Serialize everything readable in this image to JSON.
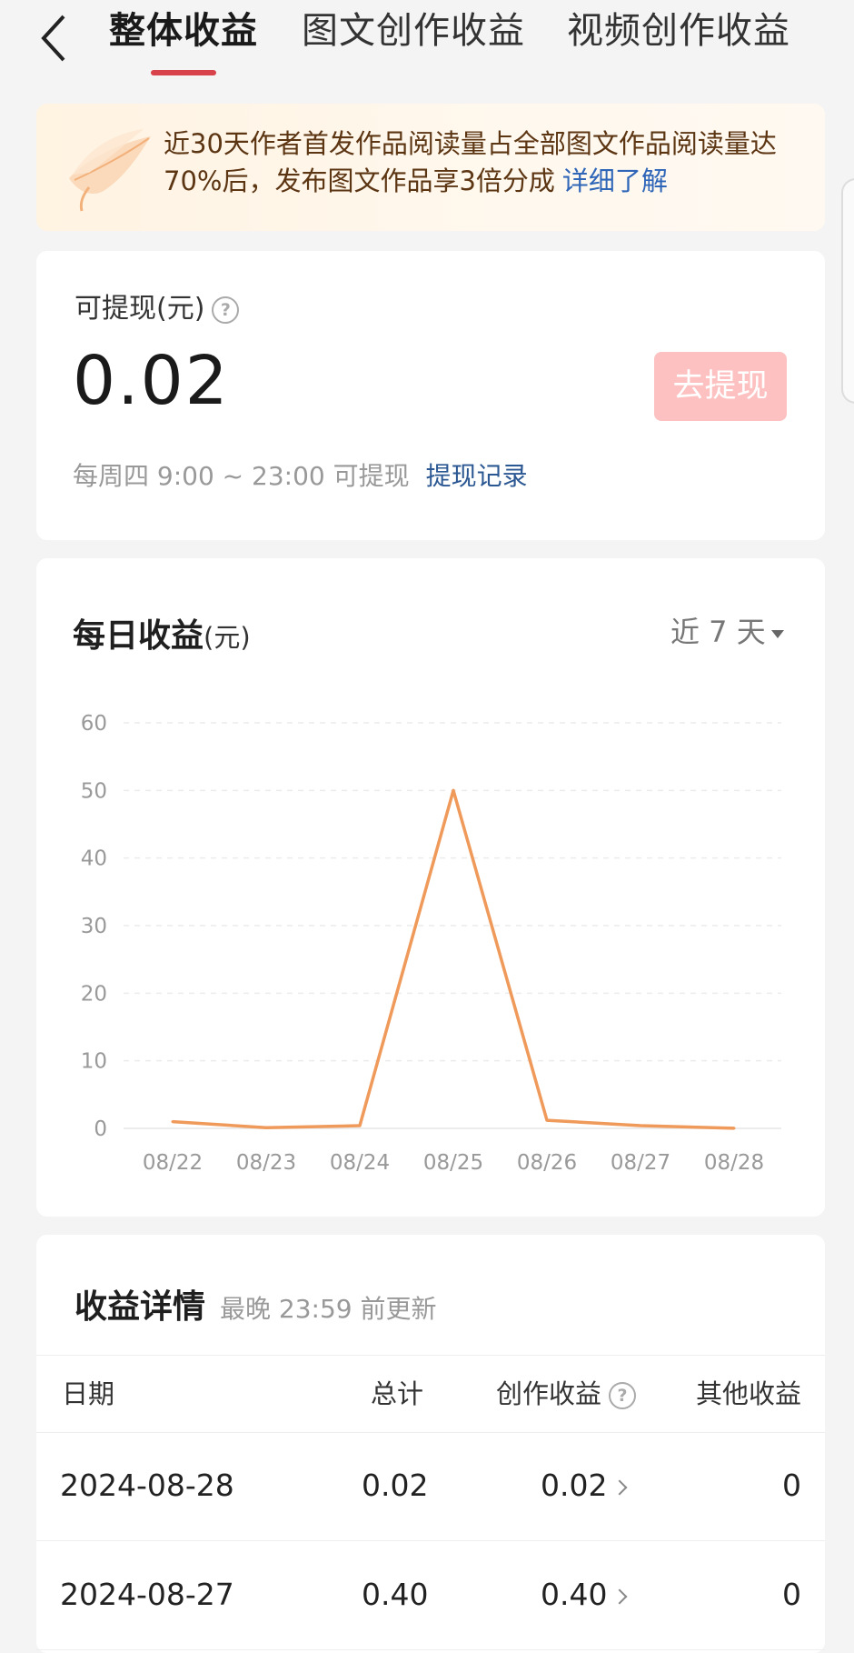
{
  "header": {
    "tabs": [
      {
        "label": "整体收益",
        "active": true
      },
      {
        "label": "图文创作收益",
        "active": false
      },
      {
        "label": "视频创作收益",
        "active": false
      }
    ]
  },
  "banner": {
    "text": "近30天作者首发作品阅读量占全部图文作品阅读量达70%后，发布图文作品享3倍分成",
    "link": "详细了解"
  },
  "withdraw": {
    "label": "可提现(元)",
    "amount": "0.02",
    "button": "去提现",
    "hint": "每周四 9:00 ~ 23:00 可提现",
    "record_link": "提现记录"
  },
  "daily_chart": {
    "title": "每日收益",
    "unit": "(元)",
    "range": "近 7 天"
  },
  "chart_data": {
    "type": "line",
    "categories": [
      "08/22",
      "08/23",
      "08/24",
      "08/25",
      "08/26",
      "08/27",
      "08/28"
    ],
    "series": [
      {
        "values": [
          1,
          0.1,
          0.4,
          50,
          1.2,
          0.4,
          0.02
        ],
        "color": "#ef9a5a"
      }
    ],
    "yticks": [
      0,
      10,
      20,
      30,
      40,
      50,
      60
    ],
    "ylim": [
      0,
      60
    ],
    "grid": true
  },
  "details": {
    "title": "收益详情",
    "subtitle": "最晚 23:59 前更新",
    "columns": [
      "日期",
      "总计",
      "创作收益",
      "其他收益"
    ],
    "rows": [
      {
        "date": "2024-08-28",
        "total": "0.02",
        "creation": "0.02",
        "other": "0"
      },
      {
        "date": "2024-08-27",
        "total": "0.40",
        "creation": "0.40",
        "other": "0"
      }
    ]
  }
}
